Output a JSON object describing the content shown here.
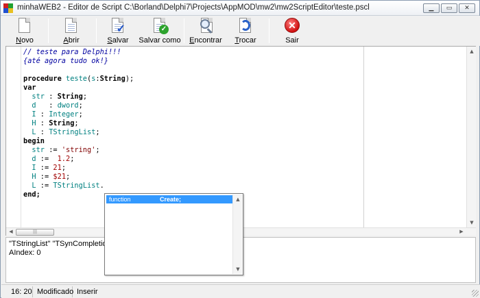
{
  "window": {
    "title": "minhaWEB2 - Editor de Script C:\\Borland\\Delphi7\\Projects\\AppMOD\\mw2\\mw2ScriptEditor\\teste.pscl",
    "buttons": {
      "minimize": "▁",
      "maximize": "▭",
      "close": "✕"
    }
  },
  "toolbar": {
    "buttons": [
      {
        "id": "novo",
        "hotkey": "N",
        "rest": "ovo",
        "icon": "new-document-icon"
      },
      {
        "id": "abrir",
        "hotkey": "A",
        "rest": "brir",
        "icon": "open-document-icon"
      },
      {
        "id": "salvar",
        "hotkey": "S",
        "rest": "alvar",
        "icon": "save-document-icon"
      },
      {
        "id": "salvar-como",
        "label": "Salvar como",
        "icon": "save-as-document-icon"
      },
      {
        "id": "encontrar",
        "hotkey": "E",
        "rest": "ncontrar",
        "icon": "find-icon"
      },
      {
        "id": "trocar",
        "hotkey": "T",
        "rest": "rocar",
        "icon": "replace-icon"
      },
      {
        "id": "sair",
        "label": "Sair",
        "icon": "exit-icon"
      }
    ]
  },
  "editor": {
    "lines": [
      [
        {
          "t": "// teste para Delphi!!!",
          "c": "comment"
        }
      ],
      [
        {
          "t": "{até agora tudo ok!}",
          "c": "comment"
        }
      ],
      [],
      [
        {
          "t": "procedure ",
          "c": "kw"
        },
        {
          "t": "teste",
          "c": "id"
        },
        {
          "t": "(",
          "c": "txt"
        },
        {
          "t": "s",
          "c": "id"
        },
        {
          "t": ":",
          "c": "txt"
        },
        {
          "t": "String",
          "c": "kw"
        },
        {
          "t": ");",
          "c": "txt"
        }
      ],
      [
        {
          "t": "var",
          "c": "kw"
        }
      ],
      [
        {
          "t": "  str",
          "c": "id"
        },
        {
          "t": " : ",
          "c": "txt"
        },
        {
          "t": "String",
          "c": "kw"
        },
        {
          "t": ";",
          "c": "txt"
        }
      ],
      [
        {
          "t": "  d",
          "c": "id"
        },
        {
          "t": "   : ",
          "c": "txt"
        },
        {
          "t": "dword",
          "c": "type"
        },
        {
          "t": ";",
          "c": "txt"
        }
      ],
      [
        {
          "t": "  I",
          "c": "id"
        },
        {
          "t": " : ",
          "c": "txt"
        },
        {
          "t": "Integer",
          "c": "type"
        },
        {
          "t": ";",
          "c": "txt"
        }
      ],
      [
        {
          "t": "  H",
          "c": "id"
        },
        {
          "t": " : ",
          "c": "txt"
        },
        {
          "t": "String",
          "c": "kw"
        },
        {
          "t": ";",
          "c": "txt"
        }
      ],
      [
        {
          "t": "  L",
          "c": "id"
        },
        {
          "t": " : ",
          "c": "txt"
        },
        {
          "t": "TStringList",
          "c": "type"
        },
        {
          "t": ";",
          "c": "txt"
        }
      ],
      [
        {
          "t": "begin",
          "c": "kw"
        }
      ],
      [
        {
          "t": "  str",
          "c": "id"
        },
        {
          "t": " := ",
          "c": "txt"
        },
        {
          "t": "'string'",
          "c": "str"
        },
        {
          "t": ";",
          "c": "txt"
        }
      ],
      [
        {
          "t": "  d",
          "c": "id"
        },
        {
          "t": " :=  ",
          "c": "txt"
        },
        {
          "t": "1.2",
          "c": "num"
        },
        {
          "t": ";",
          "c": "txt"
        }
      ],
      [
        {
          "t": "  I",
          "c": "id"
        },
        {
          "t": " := ",
          "c": "txt"
        },
        {
          "t": "21",
          "c": "num"
        },
        {
          "t": ";",
          "c": "txt"
        }
      ],
      [
        {
          "t": "  H",
          "c": "id"
        },
        {
          "t": " := ",
          "c": "txt"
        },
        {
          "t": "$21",
          "c": "num"
        },
        {
          "t": ";",
          "c": "txt"
        }
      ],
      [
        {
          "t": "  L",
          "c": "id"
        },
        {
          "t": " := ",
          "c": "txt"
        },
        {
          "t": "TStringList",
          "c": "type"
        },
        {
          "t": ".",
          "c": "txt"
        }
      ],
      [
        {
          "t": "end;",
          "c": "kw"
        }
      ]
    ]
  },
  "completion": {
    "items": [
      {
        "kind": "function",
        "name": "Create;",
        "selected": true
      }
    ]
  },
  "output": {
    "line1": "\"TStringList\" \"TSynCompletionP",
    "line2": "AIndex: 0"
  },
  "status": {
    "position": "16: 20",
    "modified": "Modificado",
    "mode": "Inserir"
  }
}
